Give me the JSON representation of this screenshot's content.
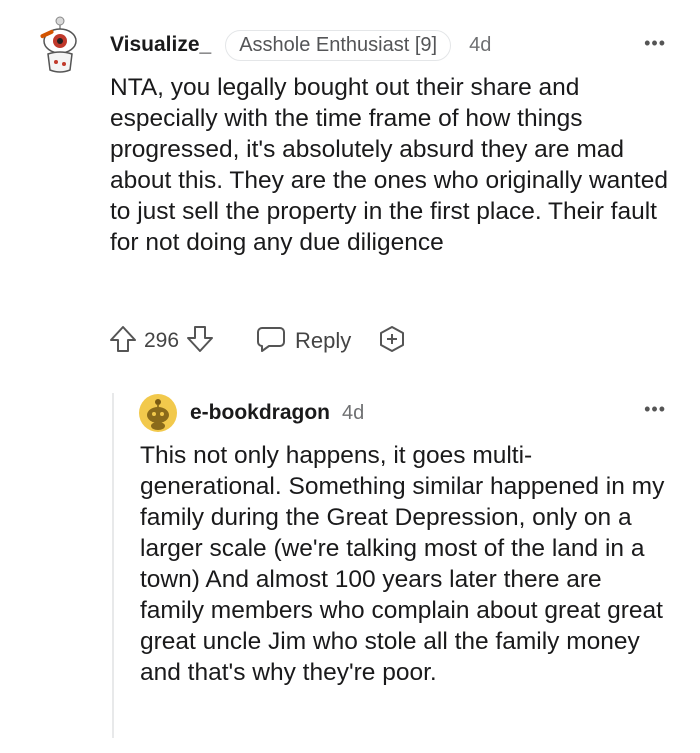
{
  "comment": {
    "username": "Visualize_",
    "flair": "Asshole Enthusiast [9]",
    "timestamp": "4d",
    "more_label": "•••",
    "body": "NTA, you legally bought out their share and especially with the time frame of how things progressed, it's absolutely absurd they are mad about this. They are the ones who originally wanted to just sell the property in the first place. Their fault for not doing any due diligence",
    "vote_count": "296",
    "reply_label": "Reply",
    "icons": {
      "upvote": "arrow-up-icon",
      "downvote": "arrow-down-icon",
      "reply": "speech-bubble-icon",
      "award": "award-plus-icon",
      "avatar": "snoo-avatar"
    }
  },
  "reply": {
    "username": "e-bookdragon",
    "timestamp": "4d",
    "more_label": "•••",
    "body": "This not only happens, it goes multi-generational. Something similar happened in my family during the Great Depression, only on a larger scale (we're talking most of the land in a town) And almost 100 years later there are family members who complain about great great great uncle Jim who stole all the family money and that's why they're poor.",
    "avatar_color": "#f2c94c"
  }
}
